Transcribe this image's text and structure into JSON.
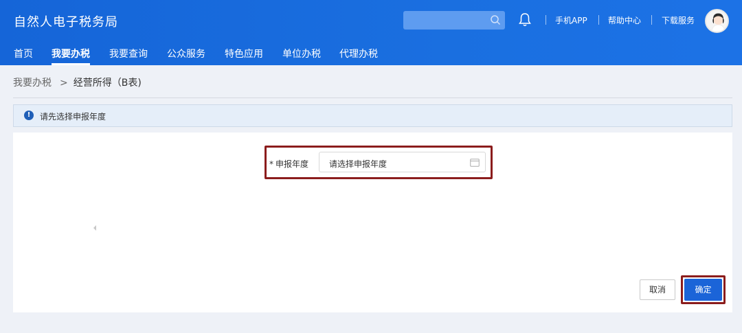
{
  "header": {
    "title": "自然人电子税务局",
    "search": {
      "placeholder": ""
    },
    "links": [
      "手机APP",
      "帮助中心",
      "下载服务"
    ]
  },
  "nav": {
    "items": [
      "首页",
      "我要办税",
      "我要查询",
      "公众服务",
      "特色应用",
      "单位办税",
      "代理办税"
    ],
    "active": "我要办税"
  },
  "breadcrumb": {
    "parent": "我要办税",
    "separator": ">",
    "current": "经营所得（B表)"
  },
  "alert": {
    "text": "请先选择申报年度"
  },
  "form": {
    "year_field": {
      "required_mark": "*",
      "label": "申报年度",
      "placeholder": "请选择申报年度"
    }
  },
  "buttons": {
    "cancel": "取消",
    "confirm": "确定"
  },
  "colors": {
    "primary": "#1b64d8",
    "highlight": "#8b1c1c"
  }
}
